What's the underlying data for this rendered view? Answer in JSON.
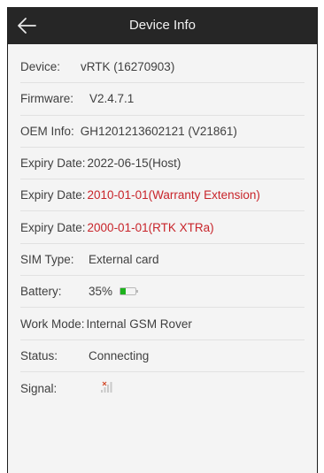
{
  "header": {
    "title": "Device Info",
    "back_icon": "arrow-left-icon"
  },
  "info": {
    "device": {
      "label": "Device:",
      "value": "vRTK (16270903)"
    },
    "firmware": {
      "label": "Firmware:",
      "value": "V2.4.7.1"
    },
    "oem": {
      "label": "OEM Info:",
      "value": "GH1201213602121 (V21861)"
    },
    "expiry_host": {
      "label": "Expiry Date:",
      "value": "2022-06-15(Host)"
    },
    "expiry_warranty": {
      "label": "Expiry Date:",
      "value": "2010-01-01(Warranty Extension)"
    },
    "expiry_xtra": {
      "label": "Expiry Date:",
      "value": "2000-01-01(RTK XTRa)"
    },
    "sim_type": {
      "label": "SIM Type:",
      "value": "External card"
    },
    "battery": {
      "label": "Battery:",
      "value": "35%",
      "level_percent": 35,
      "fill_color": "#1db21d"
    },
    "work_mode": {
      "label": "Work Mode:",
      "value": "Internal GSM Rover"
    },
    "status": {
      "label": "Status:",
      "value": "Connecting"
    },
    "signal": {
      "label": "Signal:",
      "icon": "signal-none-icon"
    }
  },
  "colors": {
    "titlebar": "#262626",
    "warning_text": "#c8242a",
    "body_background": "#f4f4f4"
  }
}
